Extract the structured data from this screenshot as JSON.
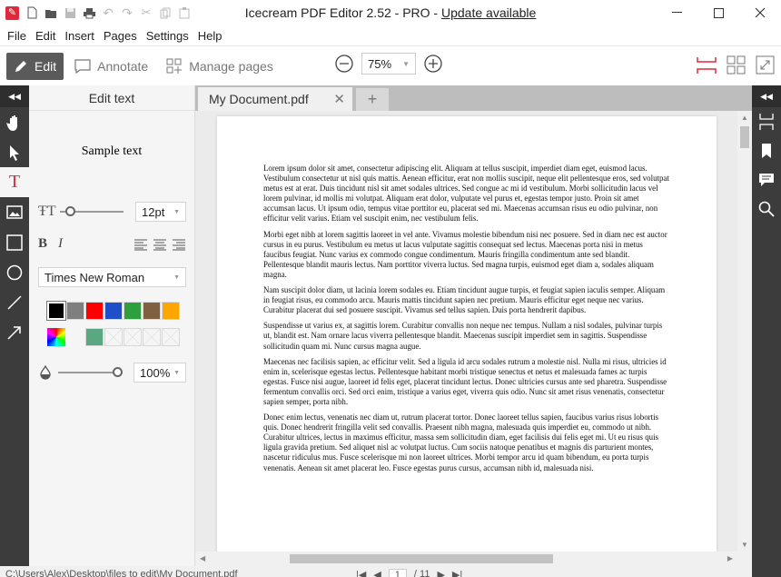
{
  "titlebar": {
    "title": "Icecream PDF Editor 2.52 - PRO - ",
    "update_link": "Update available"
  },
  "menu": [
    "File",
    "Edit",
    "Insert",
    "Pages",
    "Settings",
    "Help"
  ],
  "toolbar": {
    "edit": "Edit",
    "annotate": "Annotate",
    "manage_pages": "Manage pages",
    "zoom": "75%"
  },
  "panel": {
    "title": "Edit text",
    "sample": "Sample text",
    "font_size": "12pt",
    "font_family": "Times New Roman",
    "opacity": "100%",
    "colors": [
      "#000000",
      "#7f7f7f",
      "#ff0000",
      "#1f4fc8",
      "#2e9e3e",
      "#7f6040",
      "#ffa500"
    ],
    "custom_color": "#5aa882"
  },
  "tab": {
    "title": "My Document.pdf"
  },
  "document": {
    "paragraphs": [
      "Lorem ipsum dolor sit amet, consectetur adipiscing elit. Aliquam at tellus suscipit, imperdiet diam eget, euismod lacus. Vestibulum consectetur ut nisl quis mattis. Aenean efficitur, erat non mollis suscipit, neque elit pellentesque eros, sed volutpat metus est at erat. Duis tincidunt nisl sit amet sodales ultrices. Sed congue ac mi id vestibulum. Morbi sollicitudin lacus vel lorem pulvinar, id mollis mi volutpat. Aliquam erat dolor, vulputate vel purus et, egestas tempor justo. Proin sit amet accumsan lacus. Ut ipsum odio, tempus vitae porttitor eu, placerat sed mi. Maecenas accumsan risus eu odio pulvinar, non efficitur velit varius. Etiam vel suscipit enim, nec vestibulum felis.",
      "Morbi eget nibh at lorem sagittis laoreet in vel ante. Vivamus molestie bibendum nisi nec posuere. Sed in diam nec est auctor cursus in eu purus. Vestibulum eu metus ut lacus vulputate sagittis consequat sed lectus. Maecenas porta nisi in metus faucibus feugiat. Nunc varius ex commodo congue condimentum. Mauris fringilla condimentum ante sed blandit. Pellentesque blandit mauris lectus. Nam porttitor viverra luctus. Sed magna turpis, euismod eget diam a, sodales aliquam magna.",
      "Nam suscipit dolor diam, ut lacinia lorem sodales eu. Etiam tincidunt augue turpis, et feugiat sapien iaculis semper. Aliquam in feugiat risus, eu commodo arcu. Mauris mattis tincidunt sapien nec pretium. Mauris efficitur eget neque nec varius. Curabitur placerat dui sed posuere suscipit. Vivamus sed tellus sapien. Duis porta hendrerit dapibus.",
      "Suspendisse ut varius ex, at sagittis lorem. Curabitur convallis non neque nec tempus. Nullam a nisl sodales, pulvinar turpis ut, blandit est. Nam ornare lacus viverra pellentesque blandit. Maecenas suscipit imperdiet sem in sagittis. Suspendisse sollicitudin quam mi. Nunc cursus magna augue.",
      "Maecenas nec facilisis sapien, ac efficitur velit. Sed a ligula id arcu sodales rutrum a molestie nisl. Nulla mi risus, ultricies id enim in, scelerisque egestas lectus. Pellentesque habitant morbi tristique senectus et netus et malesuada fames ac turpis egestas. Fusce nisi augue, laoreet id felis eget, placerat tincidunt lectus. Donec ultricies cursus ante sed pharetra. Suspendisse fermentum convallis orci. Sed orci enim, tristique a varius eget, viverra quis odio. Nunc sit amet risus venenatis, consectetur sapien semper, porta nibh.",
      "Donec enim lectus, venenatis nec diam ut, rutrum placerat tortor. Donec laoreet tellus sapien, faucibus varius risus lobortis quis. Donec hendrerit fringilla velit sed convallis. Praesent nibh magna, malesuada quis imperdiet eu, commodo ut nibh. Curabitur ultrices, lectus in maximus efficitur, massa sem sollicitudin diam, eget facilisis dui felis eget mi. Ut eu risus quis ligula gravida pretium. Sed aliquet nisl ac volutpat luctus. Cum sociis natoque penatibus et magnis dis parturient montes, nascetur ridiculus mus. Fusce scelerisque mi non laoreet ultrices. Morbi tempor arcu id quam bibendum, eu porta turpis venenatis. Aenean sit amet placerat leo. Fusce egestas purus cursus, accumsan nibh id, malesuada nisi."
    ]
  },
  "status": {
    "path": "C:\\Users\\Alex\\Desktop\\files to edit\\My Document.pdf",
    "page": "1",
    "of": "/ 11"
  }
}
